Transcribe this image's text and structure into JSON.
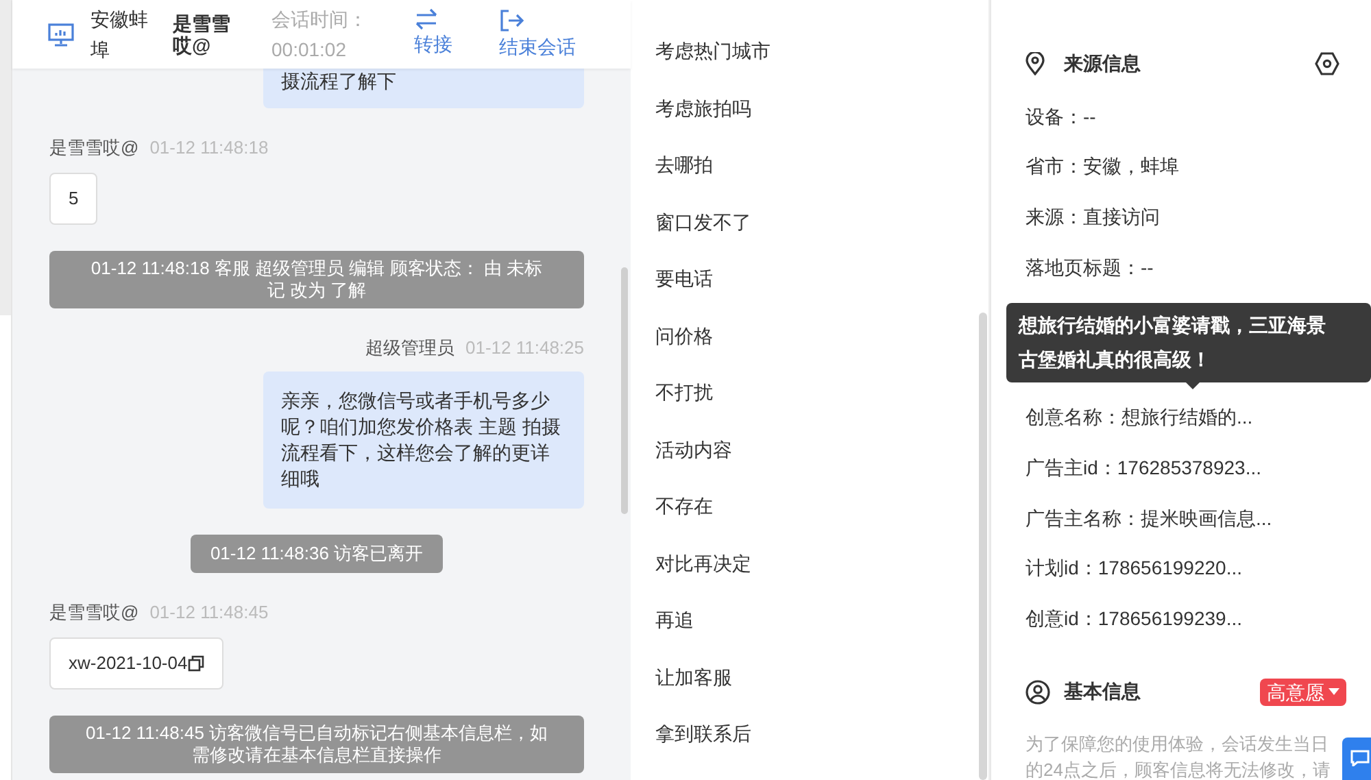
{
  "header": {
    "location": "安徽蚌埠",
    "visitor": "是雪雪哎@",
    "timer_label": "会话时间：",
    "timer": "00:01:02",
    "actions": [
      {
        "kind": "transfer",
        "label": "转接"
      },
      {
        "kind": "end",
        "label": "结束会话"
      }
    ]
  },
  "messages": [
    {
      "kind": "agent",
      "text": "摄流程了解下",
      "partial": true
    },
    {
      "kind": "visitor",
      "name": "是雪雪哎@",
      "time": "01-12 11:48:18",
      "text": "5"
    },
    {
      "kind": "system",
      "text": "01-12 11:48:18 客服 超级管理员 编辑 顾客状态： 由 未标记 改为 了解",
      "wide": true
    },
    {
      "kind": "agent",
      "name": "超级管理员",
      "time": "01-12 11:48:25",
      "text": "亲亲，您微信号或者手机号多少呢？咱们加您发价格表 主题 拍摄流程看下，这样您会了解的更详细哦"
    },
    {
      "kind": "system",
      "text": "01-12 11:48:36 访客已离开",
      "wide": false
    },
    {
      "kind": "visitor",
      "name": "是雪雪哎@",
      "time": "01-12 11:48:45",
      "text": "xw-2021-10-04",
      "copy": true
    },
    {
      "kind": "system",
      "text": "01-12 11:48:45 访客微信号已自动标记右侧基本信息栏，如需修改请在基本信息栏直接操作",
      "wide": true
    }
  ],
  "quick_replies": [
    "考虑热门城市",
    "考虑旅拍吗",
    "去哪拍",
    "窗口发不了",
    "要电话",
    "问价格",
    "不打扰",
    "活动内容",
    "不存在",
    "对比再决定",
    "再追",
    "让加客服",
    "拿到联系后"
  ],
  "source_info": {
    "title": "来源信息",
    "rows_above": [
      "设备：--",
      "省市：安徽，蚌埠",
      "来源：直接访问",
      "落地页标题：--"
    ],
    "rows_below": [
      "创意名称：想旅行结婚的...",
      "广告主id：176285378923...",
      "广告主名称：提米映画信息...",
      "计划id：178656199220...",
      "创意id：178656199239..."
    ]
  },
  "tooltip": "想旅行结婚的小富婆请戳，三亚海景古堡婚礼真的很高级！",
  "basic_info": {
    "title": "基本信息",
    "intent": "高意愿",
    "note": "为了保障您的使用体验，会话发生当日的24点之后，顾客信息将无法修改，请"
  }
}
